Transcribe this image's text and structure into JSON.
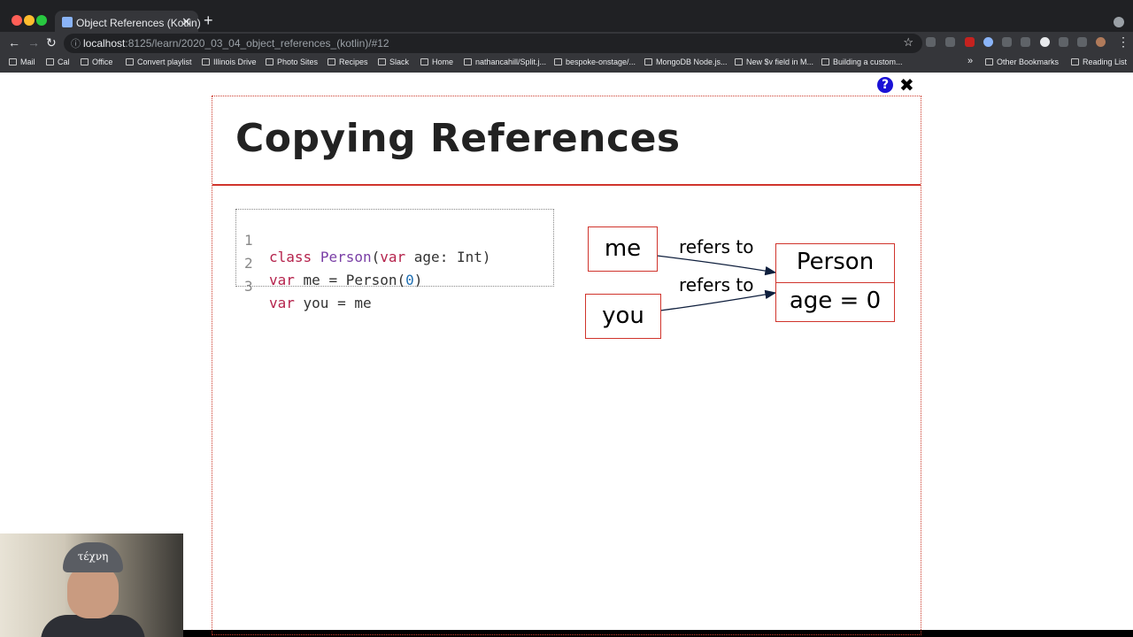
{
  "browser": {
    "tab_title": "Object References (Kotlin)",
    "tab_close": "✕",
    "new_tab": "+",
    "url_host": "localhost",
    "url_path": ":8125/learn/2020_03_04_object_references_(kotlin)/#12",
    "bookmarks": [
      "Mail",
      "Cal",
      "Office",
      "Convert playlist",
      "Illinois Drive",
      "Photo Sites",
      "Recipes",
      "Slack",
      "Home",
      "nathancahill/Split.j...",
      "bespoke-onstage/...",
      "MongoDB Node.js...",
      "New $v field in M...",
      "Building a custom..."
    ],
    "more_bookmarks": "»",
    "other_bookmarks": "Other Bookmarks",
    "reading_list": "Reading List"
  },
  "slide": {
    "help_label": "?",
    "close_label": "✖",
    "title": "Copying References",
    "code": {
      "line_numbers": [
        "1",
        "2",
        "3"
      ],
      "line1": {
        "kw1": "class",
        "cls": "Person",
        "p1": "(",
        "kw2": "var",
        "rest": " age: Int)"
      },
      "line2": {
        "kw": "var",
        "mid": " me = Person(",
        "num": "0",
        "end": ")"
      },
      "line3": {
        "kw": "var",
        "rest": " you = me"
      }
    },
    "diagram": {
      "nodes": {
        "me": "me",
        "you": "you",
        "person_name": "Person",
        "person_field": "age = 0"
      },
      "edges": [
        "refers to",
        "refers to"
      ]
    }
  },
  "colors": {
    "accent_red": "#d0342c",
    "keyword": "#b5234c",
    "class_name": "#7a3fa6",
    "number": "#1f6fb2",
    "help_blue": "#1a11d6"
  }
}
